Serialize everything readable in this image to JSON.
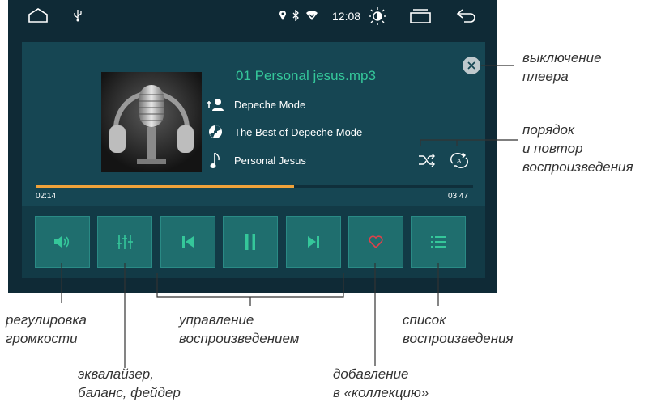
{
  "status_bar": {
    "time": "12:08"
  },
  "player": {
    "track_title": "01 Personal jesus.mp3",
    "artist": "Depeche Mode",
    "album": "The Best of Depeche Mode",
    "song": "Personal Jesus",
    "elapsed": "02:14",
    "total": "03:47",
    "progress_fraction": 0.59,
    "accent_color": "#35c79a",
    "progress_color": "#f0a23a",
    "favorite_color": "#e0404a"
  },
  "controls": [
    {
      "id": "volume",
      "icon": "volume-icon"
    },
    {
      "id": "equalizer",
      "icon": "equalizer-icon"
    },
    {
      "id": "previous",
      "icon": "previous-track-icon"
    },
    {
      "id": "play-pause",
      "icon": "pause-icon"
    },
    {
      "id": "next",
      "icon": "next-track-icon"
    },
    {
      "id": "favorite",
      "icon": "heart-icon"
    },
    {
      "id": "playlist",
      "icon": "playlist-icon"
    }
  ],
  "annotations": {
    "close_line1": "выключение",
    "close_line2": "плеера",
    "mode_line1": "порядок",
    "mode_line2": "и повтор",
    "mode_line3": "воспроизведения",
    "volume_line1": "регулировка",
    "volume_line2": "громкости",
    "playback_line1": "управление",
    "playback_line2": "воспроизведением",
    "playlist_line1": "список",
    "playlist_line2": "воспроизведения",
    "eq_line1": "эквалайзер,",
    "eq_line2": "баланс, фейдер",
    "fav_line1": "добавление",
    "fav_line2": "в «коллекцию»"
  }
}
